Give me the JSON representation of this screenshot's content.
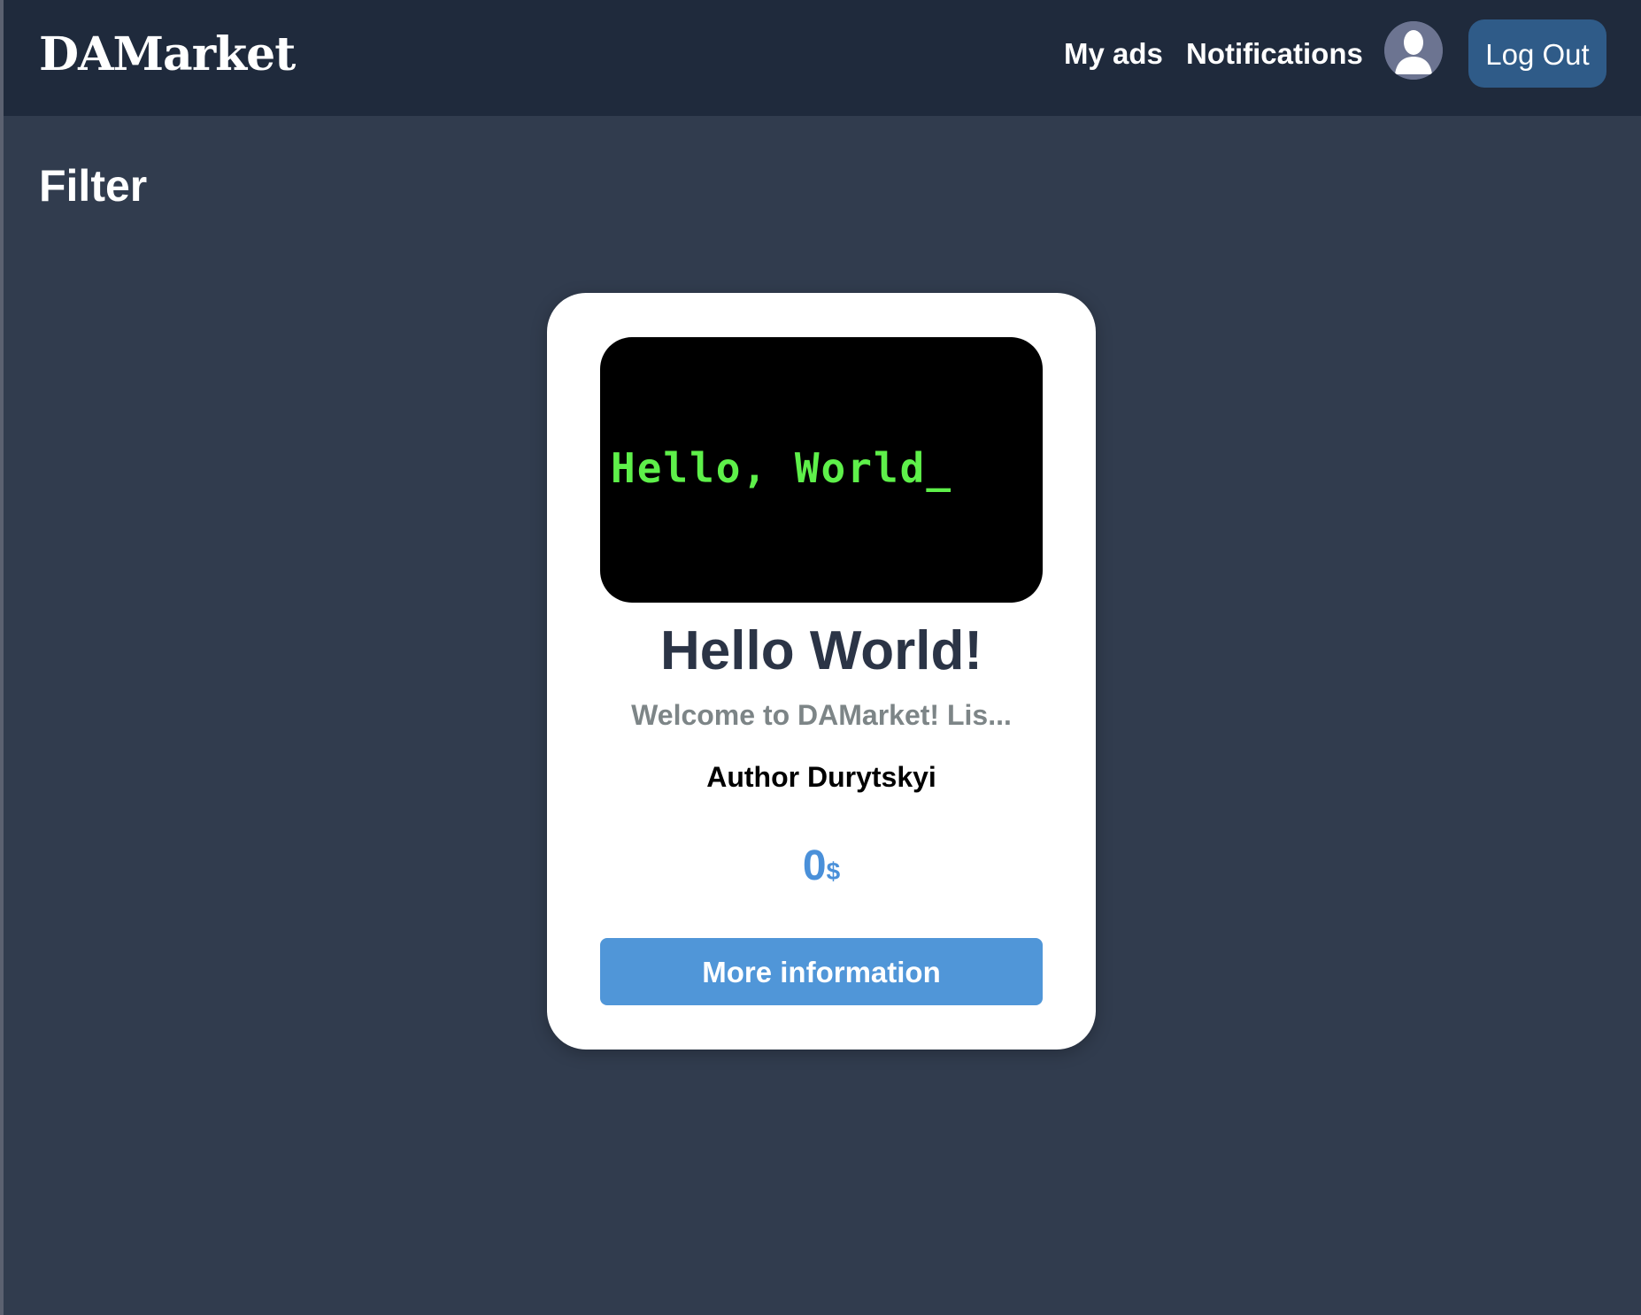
{
  "header": {
    "logo": "DAMarket",
    "nav": {
      "my_ads": "My ads",
      "notifications": "Notifications"
    },
    "avatar_icon": "user-avatar-icon",
    "logout_label": "Log Out"
  },
  "filter": {
    "title": "Filter"
  },
  "listing": {
    "image_text": "Hello, World_",
    "title": "Hello World!",
    "description": "Welcome to DAMarket! Lis...",
    "author": "Author Durytskyi",
    "price_value": "0",
    "price_currency": "$",
    "more_info_label": "More information"
  },
  "colors": {
    "page_background": "#313c4e",
    "header_background": "#1f2a3c",
    "logout_button": "#2f5b88",
    "card_background": "#ffffff",
    "accent_blue": "#5096d8",
    "price_blue": "#4a90d9",
    "terminal_green": "#5ef04a",
    "title_text": "#2b3446",
    "description_text": "#7d8587"
  }
}
